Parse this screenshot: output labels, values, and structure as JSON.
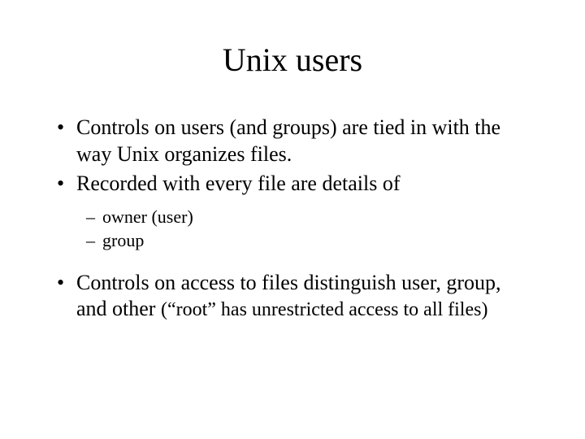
{
  "title": "Unix users",
  "bullets": {
    "b1": "Controls on users (and groups) are tied in with the way Unix organizes files.",
    "b2": "Recorded with every file are details of",
    "b2_sub": {
      "s1": "owner (user)",
      "s2": "group"
    },
    "b3_main": "Controls on access to files distinguish user, group, and other  ",
    "b3_paren": "(“root” has unrestricted access to all files)"
  }
}
